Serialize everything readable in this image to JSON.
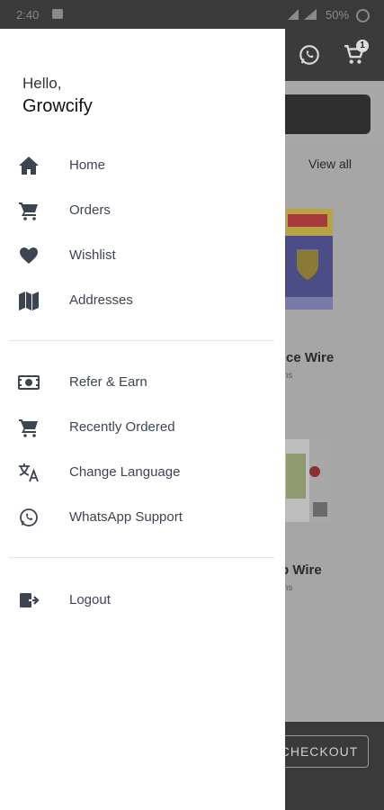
{
  "status_bar": {
    "time": "2:40",
    "battery": "50%"
  },
  "app_bar": {
    "cart_count": "1"
  },
  "background": {
    "view_all": "View all",
    "products": [
      {
        "name_fragment": "ce Wire",
        "sub_fragment": "ms"
      },
      {
        "name_fragment": "b Wire",
        "sub_fragment": "ms"
      }
    ],
    "checkout_label": "CHECKOUT"
  },
  "drawer": {
    "greeting": "Hello,",
    "username": "Growcify",
    "primary_items": [
      {
        "label": "Home",
        "icon": "home-icon"
      },
      {
        "label": "Orders",
        "icon": "cart-icon"
      },
      {
        "label": "Wishlist",
        "icon": "heart-icon"
      },
      {
        "label": "Addresses",
        "icon": "map-icon"
      }
    ],
    "secondary_items": [
      {
        "label": "Refer & Earn",
        "icon": "money-icon"
      },
      {
        "label": "Recently Ordered",
        "icon": "cart-icon"
      },
      {
        "label": "Change Language",
        "icon": "translate-icon"
      },
      {
        "label": "WhatsApp Support",
        "icon": "whatsapp-icon"
      }
    ],
    "logout_item": {
      "label": "Logout",
      "icon": "logout-icon"
    }
  }
}
